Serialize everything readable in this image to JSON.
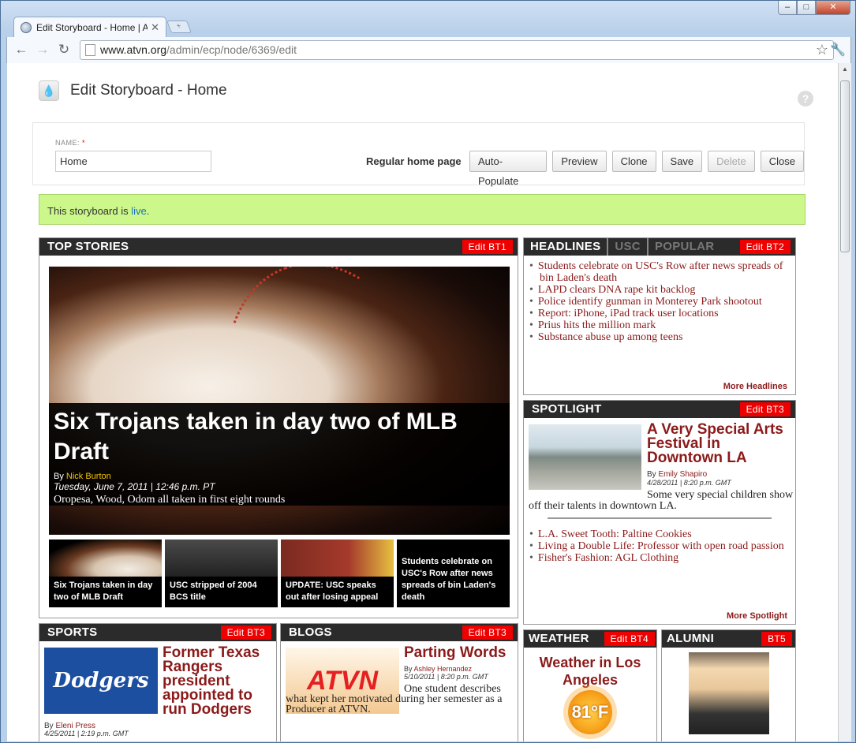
{
  "browser": {
    "tab_title": "Edit Storyboard - Home | A",
    "url_host": "www.atvn.org",
    "url_path": "/admin/ecp/node/6369/edit"
  },
  "page": {
    "title": "Edit Storyboard - Home",
    "help": "?"
  },
  "form": {
    "name_label": "NAME:",
    "required_mark": "*",
    "name_value": "Home",
    "type_label": "Regular home page",
    "buttons": {
      "auto_populate": "Auto-Populate",
      "preview": "Preview",
      "clone": "Clone",
      "save": "Save",
      "delete": "Delete",
      "close": "Close"
    }
  },
  "notice": {
    "text": "This storyboard is ",
    "link": "live",
    "tail": "."
  },
  "top_stories": {
    "heading": "TOP STORIES",
    "edit": "Edit BT1",
    "hero": {
      "title": "Six Trojans taken in day two of MLB Draft",
      "by": "By ",
      "author": "Nick Burton",
      "date": "Tuesday, June 7, 2011 | 12:46 p.m. PT",
      "subtitle": "Oropesa, Wood, Odom all taken in first eight rounds"
    },
    "thumbs": [
      "Six Trojans taken in day two of MLB Draft",
      "USC stripped of 2004 BCS title",
      "UPDATE: USC speaks out after losing appeal",
      "Students celebrate on USC's Row after news spreads of bin Laden's death"
    ]
  },
  "headlines": {
    "tabs": [
      "HEADLINES",
      "USC",
      "POPULAR"
    ],
    "edit": "Edit BT2",
    "items": [
      "Students celebrate on USC's Row after news spreads of bin Laden's death",
      "LAPD clears DNA rape kit backlog",
      "Police identify gunman in Monterey Park shootout",
      "Report: iPhone, iPad track user locations",
      "Prius hits the million mark",
      "Substance abuse up among teens"
    ],
    "more": "More Headlines"
  },
  "spotlight": {
    "heading": "SPOTLIGHT",
    "edit": "Edit BT3",
    "title": "A Very Special Arts Festival in Downtown LA",
    "by": "By ",
    "author": "Emily Shapiro",
    "date": "4/28/2011 | 8:20 p.m. GMT",
    "desc": "Some very special children show off their talents in downtown LA.",
    "items": [
      "L.A. Sweet Tooth: Paltine Cookies",
      "Living a Double Life: Professor with open road passion",
      "Fisher's Fashion: AGL Clothing"
    ],
    "more": "More Spotlight"
  },
  "sports": {
    "heading": "SPORTS",
    "edit": "Edit BT3",
    "image_text": "Dodgers",
    "title": "Former Texas Rangers president appointed to run Dodgers",
    "by": "By ",
    "author": "Eleni Press",
    "date": "4/25/2011 | 2:19 p.m. GMT"
  },
  "blogs": {
    "heading": "BLOGS",
    "edit": "Edit BT3",
    "image_text": "ATVN",
    "title": "Parting Words",
    "by": "By ",
    "author": "Ashley Hernandez",
    "date": "5/10/2011 | 8:20 p.m. GMT",
    "desc": "One student describes what kept her motivated during her semester as a Producer at ATVN."
  },
  "weather": {
    "heading": "WEATHER",
    "edit": "Edit BT4",
    "title": "Weather in Los Angeles",
    "temp": "81°F"
  },
  "alumni": {
    "heading": "ALUMNI",
    "edit": "BT5"
  }
}
